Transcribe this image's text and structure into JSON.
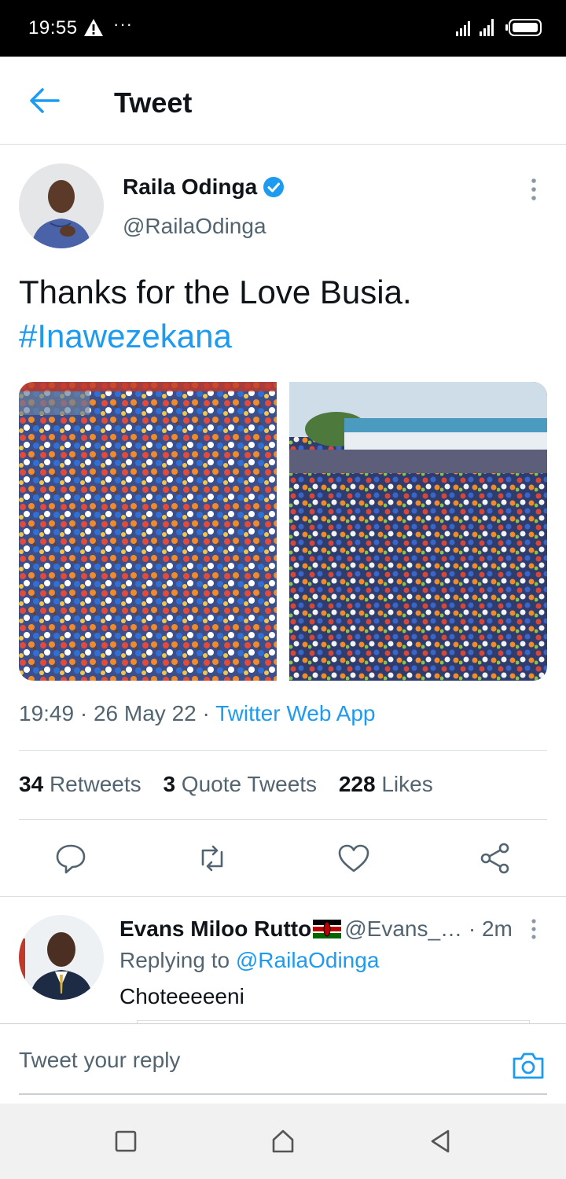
{
  "status_bar": {
    "time": "19:55",
    "dots": "···"
  },
  "header": {
    "title": "Tweet"
  },
  "tweet": {
    "author_name": "Raila Odinga",
    "author_handle": "@RailaOdinga",
    "text": "Thanks for the Love Busia.",
    "hashtag": "#Inawezekana",
    "time": "19:49",
    "date": "26 May 22",
    "source": "Twitter Web App",
    "separator": " · "
  },
  "stats": {
    "retweets_count": "34",
    "retweets_label": "Retweets",
    "quotes_count": "3",
    "quotes_label": "Quote Tweets",
    "likes_count": "228",
    "likes_label": "Likes"
  },
  "reply": {
    "name": "Evans Miloo Rutto",
    "handle": "@Evans_…",
    "age": " · 2m",
    "replying_prefix": "Replying to ",
    "replying_to": "@RailaOdinga",
    "text": "Choteeeeeni"
  },
  "compose": {
    "placeholder": "Tweet your reply"
  },
  "colors": {
    "accent": "#1d9bf0",
    "muted": "#536471",
    "text": "#0f1419",
    "divider": "#d9dee3"
  },
  "icons": {
    "back": "arrow-left-icon",
    "verified": "verified-badge-icon",
    "more": "more-vertical-icon",
    "reply": "reply-icon",
    "retweet": "retweet-icon",
    "like": "heart-icon",
    "share": "share-icon",
    "camera": "camera-icon",
    "flag": "kenya-flag-icon",
    "warning": "warning-icon"
  }
}
